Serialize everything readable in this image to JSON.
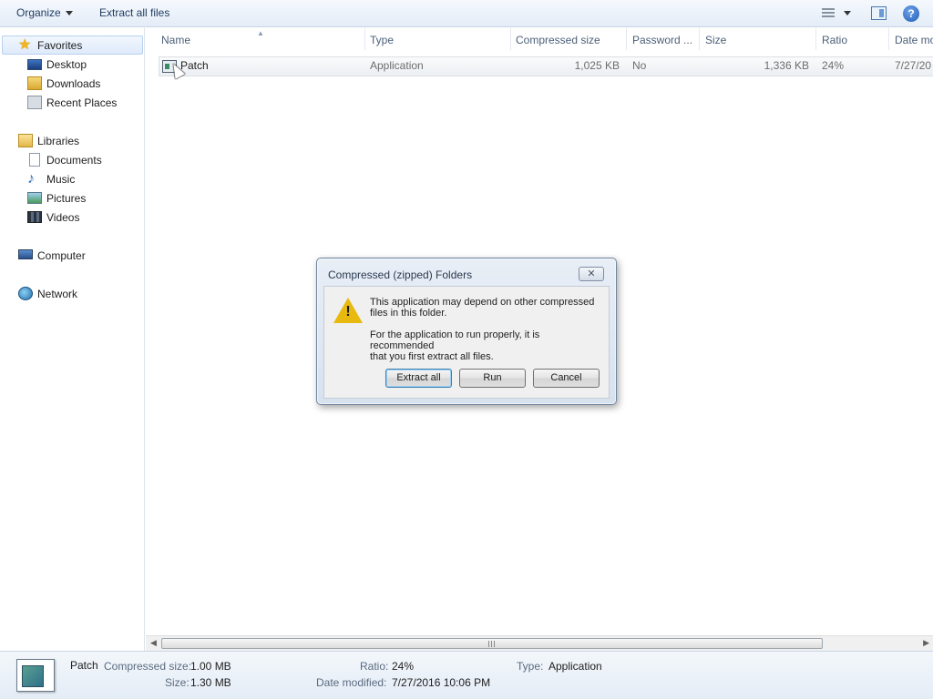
{
  "toolbar": {
    "organize_label": "Organize",
    "extract_label": "Extract all files",
    "views_icon": "views-icon",
    "preview_icon": "preview-pane-icon",
    "help_icon": "help-icon",
    "help_glyph": "?"
  },
  "nav": {
    "favorites": "Favorites",
    "desktop": "Desktop",
    "downloads": "Downloads",
    "recent": "Recent Places",
    "libraries": "Libraries",
    "documents": "Documents",
    "music": "Music",
    "pictures": "Pictures",
    "videos": "Videos",
    "computer": "Computer",
    "network": "Network"
  },
  "columns": {
    "name": "Name",
    "type": "Type",
    "compressed": "Compressed size",
    "password": "Password ...",
    "size": "Size",
    "ratio": "Ratio",
    "date": "Date mo"
  },
  "files": [
    {
      "name": "Patch",
      "type": "Application",
      "compressed": "1,025 KB",
      "password": "No",
      "size": "1,336 KB",
      "ratio": "24%",
      "date": "7/27/20"
    }
  ],
  "details": {
    "name": "Patch",
    "compressed_label": "Compressed size:",
    "compressed_value": "1.00 MB",
    "size_label": "Size:",
    "size_value": "1.30 MB",
    "ratio_label": "Ratio:",
    "ratio_value": "24%",
    "date_label": "Date modified:",
    "date_value": "7/27/2016 10:06 PM",
    "type_label": "Type:",
    "type_value": "Application"
  },
  "dialog": {
    "title": "Compressed (zipped) Folders",
    "close_glyph": "✕",
    "msg1_line1": "This application may depend on other compressed",
    "msg1_line2": "files in this folder.",
    "msg2_line1": "For the application to run properly, it is recommended",
    "msg2_line2": "that you first extract all files.",
    "extract_btn": "Extract all",
    "run_btn": "Run",
    "cancel_btn": "Cancel",
    "warning_glyph": "!"
  },
  "glyphs": {
    "star": "★",
    "note": "♪",
    "sort_up": "▲",
    "scroll_left": "◀",
    "scroll_right": "▶"
  }
}
